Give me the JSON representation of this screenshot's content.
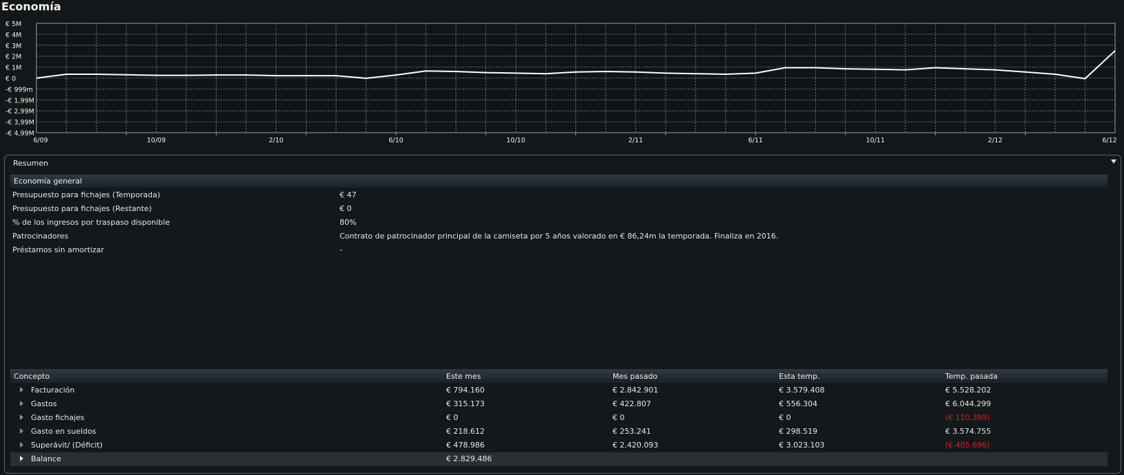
{
  "title": "Economía",
  "colors": {
    "line": "#ffffff",
    "grid": "#9aa0a6",
    "negative": "#d12020",
    "header_gradient": "#2f3a43"
  },
  "chart_data": {
    "type": "line",
    "y_tick_labels": [
      "€ 5M",
      "€ 4M",
      "€ 3M",
      "€ 2M",
      "€ 1M",
      "€ 0",
      "-€ 999m",
      "-€ 1,99M",
      "-€ 2,99M",
      "-€ 3,99M",
      "-€ 4,99M"
    ],
    "ylim": [
      -4.99,
      5
    ],
    "x_tick_labels": [
      "6/09",
      "10/09",
      "2/10",
      "6/10",
      "10/10",
      "2/11",
      "6/11",
      "10/11",
      "2/12",
      "6/12"
    ],
    "x": [
      0,
      1,
      2,
      3,
      4,
      5,
      6,
      7,
      8,
      9,
      10,
      11,
      12,
      13,
      14,
      15,
      16,
      17,
      18,
      19,
      20,
      21,
      22,
      23,
      24,
      25,
      26,
      27,
      28,
      29,
      30,
      31,
      32,
      33,
      34,
      35,
      36
    ],
    "values": [
      0.0,
      0.35,
      0.35,
      0.3,
      0.25,
      0.25,
      0.28,
      0.28,
      0.22,
      0.22,
      0.22,
      -0.02,
      0.28,
      0.65,
      0.6,
      0.5,
      0.45,
      0.4,
      0.55,
      0.6,
      0.55,
      0.45,
      0.4,
      0.35,
      0.45,
      0.95,
      0.95,
      0.85,
      0.8,
      0.75,
      0.95,
      0.85,
      0.75,
      0.55,
      0.35,
      -0.05,
      2.5
    ],
    "grid": true
  },
  "summary": {
    "label": "Resumen",
    "general": {
      "title": "Economía general",
      "rows": [
        {
          "label": "Presupuesto para fichajes (Temporada)",
          "value": "€ 47"
        },
        {
          "label": "Presupuesto para fichajes (Restante)",
          "value": "€ 0"
        },
        {
          "label": "% de los ingresos por traspaso disponible",
          "value": "80%"
        },
        {
          "label": "Patrocinadores",
          "value": "Contrato de patrocinador principal de la camiseta por 5 años valorado en € 86,24m la temporada. Finaliza en 2016."
        },
        {
          "label": "Préstamos sin amortizar",
          "value": "-"
        }
      ]
    },
    "table": {
      "headers": [
        "Concepto",
        "Este mes",
        "Mes pasado",
        "Esta temp.",
        "Temp. pasada"
      ],
      "rows": [
        {
          "name": "Facturación",
          "c1": "€ 794.160",
          "c2": "€ 2.842.901",
          "c3": "€ 3.579.408",
          "c4": "€ 5.528.202",
          "neg": false
        },
        {
          "name": "Gastos",
          "c1": "€ 315.173",
          "c2": "€ 422.807",
          "c3": "€ 556.304",
          "c4": "€ 6.044.299",
          "neg": false
        },
        {
          "name": "Gasto fichajes",
          "c1": "€ 0",
          "c2": "€ 0",
          "c3": "€ 0",
          "c4": "(€ 110.399)",
          "neg": true
        },
        {
          "name": "Gasto en sueldos",
          "c1": "€ 218.612",
          "c2": "€ 253.241",
          "c3": "€ 298.519",
          "c4": "€ 3.574.755",
          "neg": false
        },
        {
          "name": "Superávit/ (Déficit)",
          "c1": "€ 478.986",
          "c2": "€ 2.420.093",
          "c3": "€ 3.023.103",
          "c4": "(€ 405.696)",
          "neg": true
        }
      ],
      "balance": {
        "name": "Balance",
        "c1": "€ 2.829.486"
      }
    }
  }
}
